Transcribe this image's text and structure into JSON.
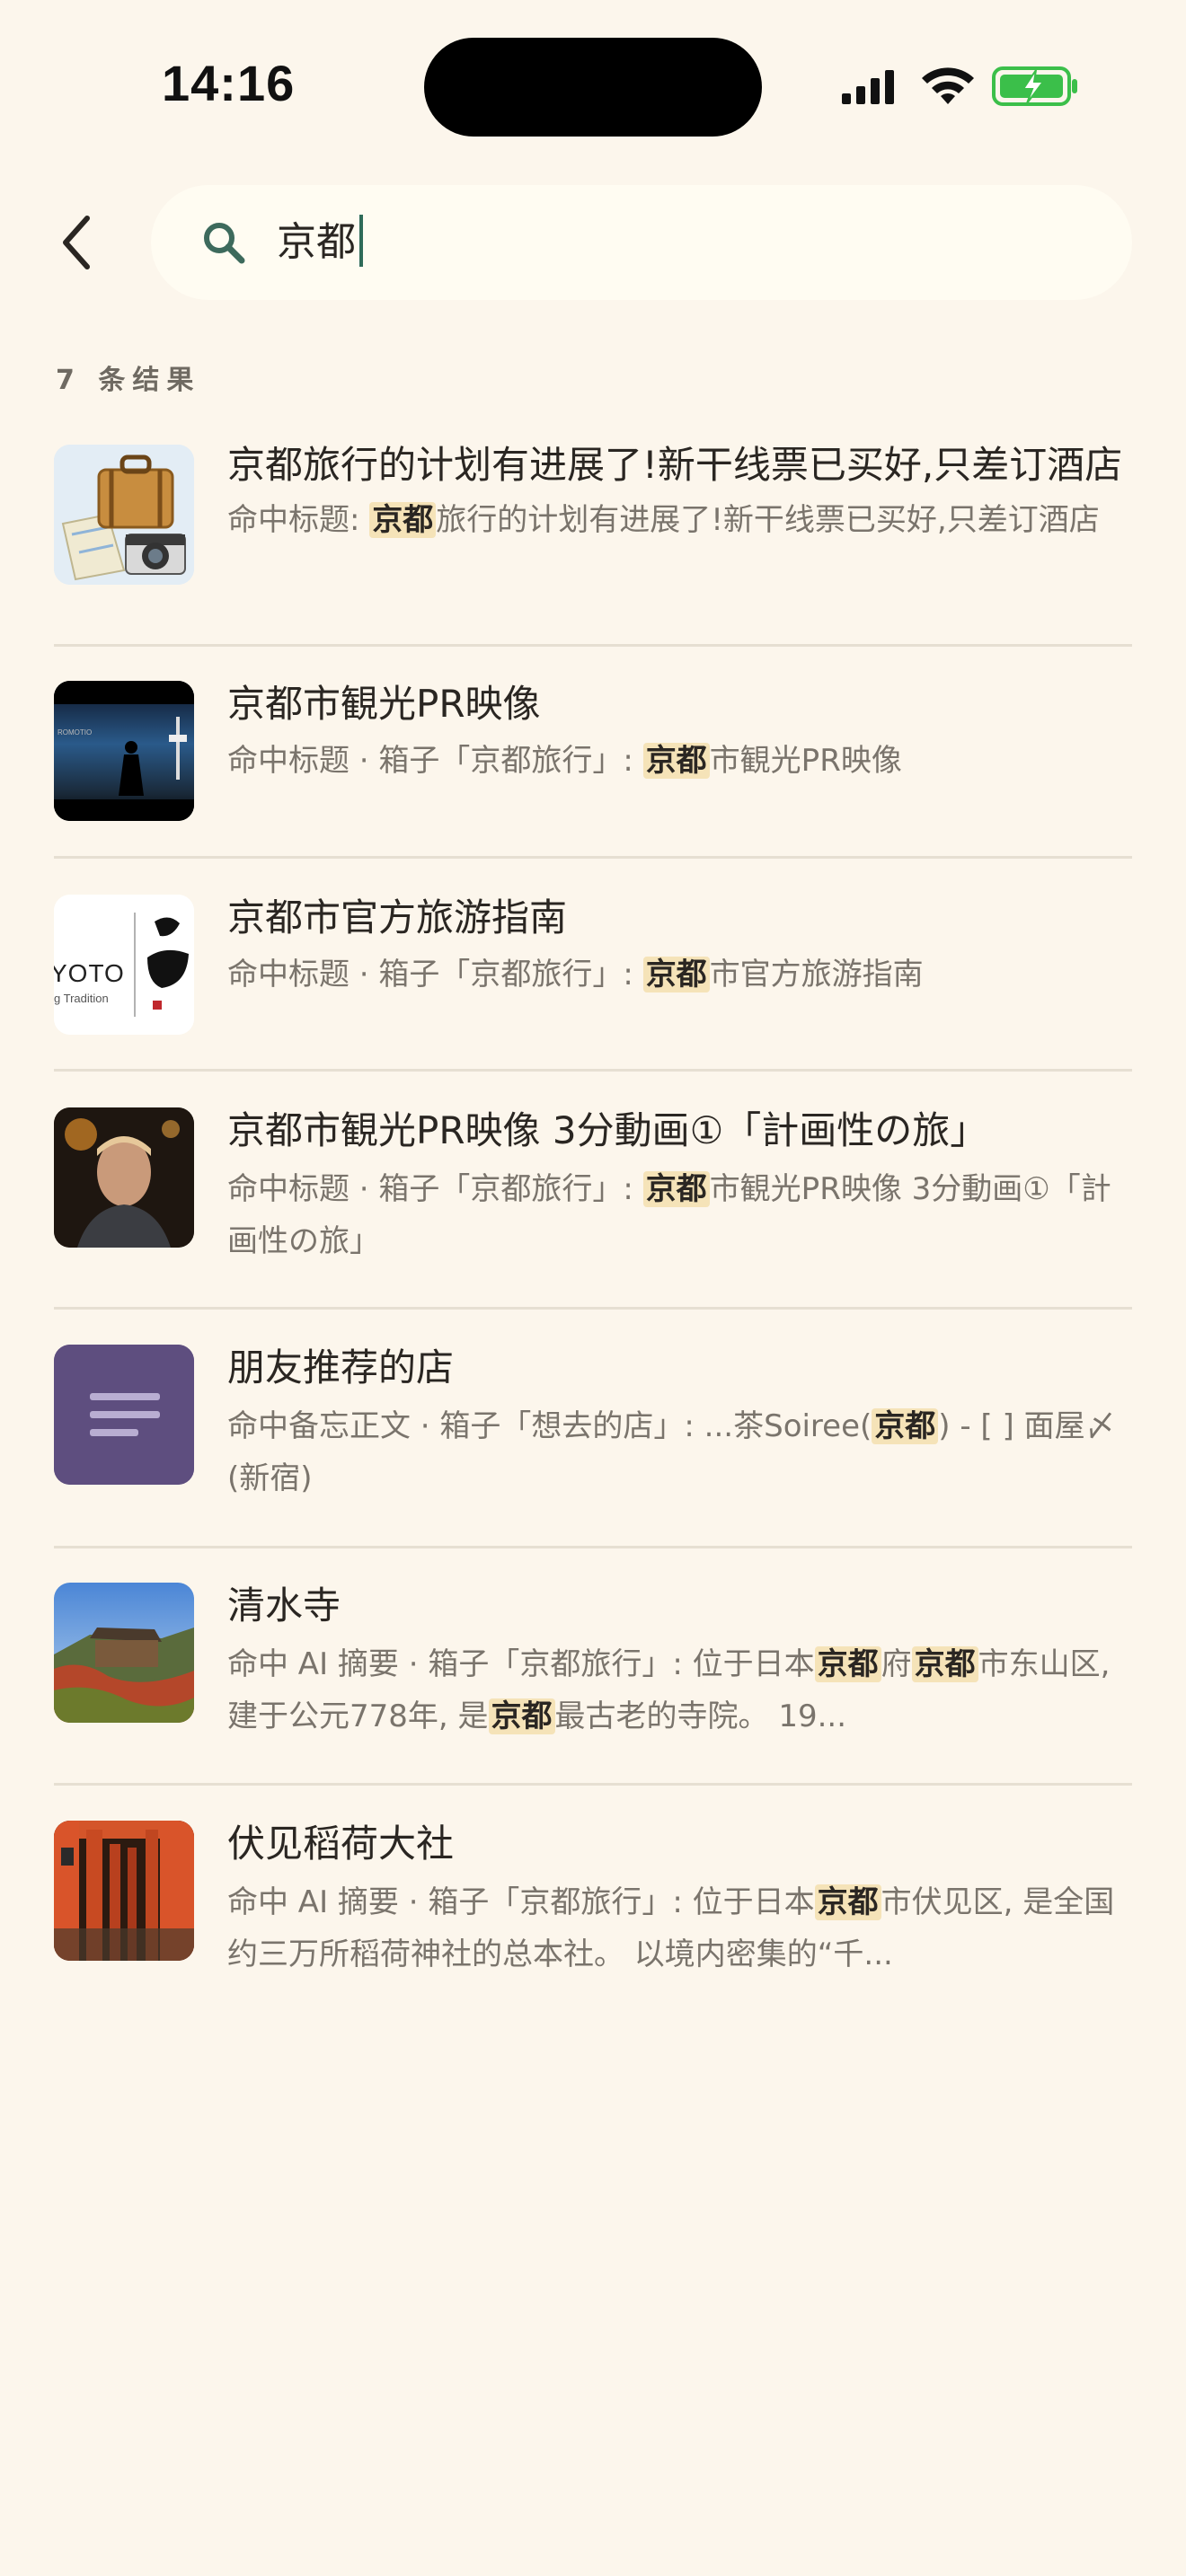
{
  "status_bar": {
    "time": "14:16"
  },
  "search": {
    "query": "京都"
  },
  "results_count": "7 条结果",
  "results": [
    {
      "title": "京都旅行的计划有进展了!新干线票已买好,只差订酒店",
      "snippet_prefix": "命中标题: ",
      "highlight": "京都",
      "snippet_suffix": "旅行的计划有进展了!新干线票已买好,只差订酒店",
      "thumbnail": "travel-suitcase-camera-map"
    },
    {
      "title": "京都市観光PR映像",
      "snippet_prefix": "命中标题 · 箱子「京都旅行」: ",
      "highlight": "京都",
      "snippet_suffix": "市観光PR映像",
      "thumbnail": "kyoto-tower-silhouette"
    },
    {
      "title": "京都市官方旅游指南",
      "snippet_prefix": "命中标题 · 箱子「京都旅行」: ",
      "highlight": "京都",
      "snippet_suffix": "市官方旅游指南",
      "thumbnail": "kyoto-logo",
      "thumb_text_1": "YOTO",
      "thumb_text_2": "g Tradition"
    },
    {
      "title": "京都市観光PR映像 3分動画①「計画性の旅」",
      "snippet_prefix": "命中标题 · 箱子「京都旅行」: ",
      "highlight": "京都",
      "snippet_suffix": "市観光PR映像 3分動画①「計画性の旅」",
      "thumbnail": "man-portrait"
    },
    {
      "title": "朋友推荐的店",
      "snippet_prefix": "命中备忘正文 · 箱子「想去的店」: ...茶Soiree(",
      "highlight": "京都",
      "snippet_suffix": ") - [ ] 面屋〆(新宿)",
      "thumbnail": "note-lines-icon"
    },
    {
      "title": "清水寺",
      "snippet_prefix": "命中 AI 摘要 · 箱子「京都旅行」: 位于日本",
      "segments": [
        {
          "text": "命中 AI 摘要 · 箱子「京都旅行」: 位于日本",
          "hl": false
        },
        {
          "text": "京都",
          "hl": true
        },
        {
          "text": "府",
          "hl": false
        },
        {
          "text": "京都",
          "hl": true
        },
        {
          "text": "市东山区, 建于公元778年, 是",
          "hl": false
        },
        {
          "text": "京都",
          "hl": true
        },
        {
          "text": "最古老的寺院。 19...",
          "hl": false
        }
      ],
      "thumbnail": "kiyomizu-temple"
    },
    {
      "title": "伏见稻荷大社",
      "segments": [
        {
          "text": "命中 AI 摘要 · 箱子「京都旅行」: 位于日本",
          "hl": false
        },
        {
          "text": "京都",
          "hl": true
        },
        {
          "text": "市伏见区, 是全国约三万所稻荷神社的总本社。 以境内密集的“千...",
          "hl": false
        }
      ],
      "thumbnail": "torii-gates"
    }
  ],
  "colors": {
    "background": "#fcf6ec",
    "highlight": "#f5e3b8",
    "battery": "#3bbf4a",
    "caret": "#2f6b59"
  }
}
